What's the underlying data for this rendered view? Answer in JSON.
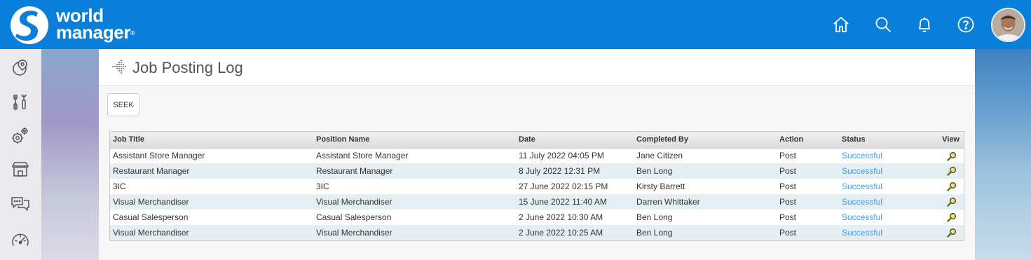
{
  "brand": {
    "line1": "world",
    "line2": "manager",
    "reg": "®"
  },
  "header_icons": [
    "home-icon",
    "search-icon",
    "bell-icon",
    "help-icon"
  ],
  "sidebar_icons": [
    "map-pin-icon",
    "tools-icon",
    "gears-icon",
    "store-icon",
    "chat-icon",
    "speedometer-icon"
  ],
  "page": {
    "title": "Job Posting Log",
    "seek_label": "SEEK"
  },
  "table": {
    "headers": {
      "job_title": "Job Title",
      "position_name": "Position Name",
      "date": "Date",
      "completed_by": "Completed By",
      "action": "Action",
      "status": "Status",
      "view": "View"
    },
    "rows": [
      {
        "job_title": "Assistant Store Manager",
        "position_name": "Assistant Store Manager",
        "date": "11 July 2022 04:05 PM",
        "completed_by": "Jane Citizen",
        "action": "Post",
        "status": "Successful"
      },
      {
        "job_title": "Restaurant Manager",
        "position_name": "Restaurant Manager",
        "date": "8 July 2022 12:31 PM",
        "completed_by": "Ben Long",
        "action": "Post",
        "status": "Successful"
      },
      {
        "job_title": "3IC",
        "position_name": "3IC",
        "date": "27 June 2022 02:15 PM",
        "completed_by": "Kirsty Barrett",
        "action": "Post",
        "status": "Successful"
      },
      {
        "job_title": "Visual Merchandiser",
        "position_name": "Visual Merchandiser",
        "date": "15 June 2022 11:40 AM",
        "completed_by": "Darren Whittaker",
        "action": "Post",
        "status": "Successful"
      },
      {
        "job_title": "Casual Salesperson",
        "position_name": "Casual Salesperson",
        "date": "2 June 2022 10:30 AM",
        "completed_by": "Ben Long",
        "action": "Post",
        "status": "Successful"
      },
      {
        "job_title": "Visual Merchandiser",
        "position_name": "Visual Merchandiser",
        "date": "2 June 2022 10:25 AM",
        "completed_by": "Ben Long",
        "action": "Post",
        "status": "Successful"
      }
    ]
  },
  "colors": {
    "header_bg": "#0a7fd9",
    "status_link": "#3a9fe0",
    "row_alt": "#e5eef3"
  }
}
